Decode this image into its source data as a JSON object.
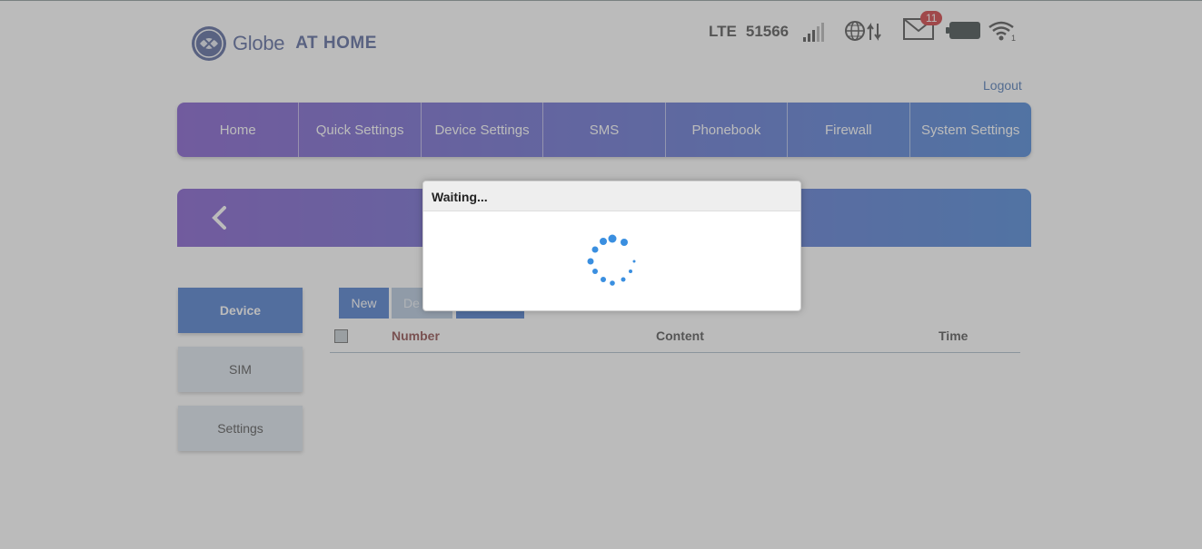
{
  "header": {
    "brand": "Globe",
    "brand_suffix": "AT HOME",
    "network_type": "LTE",
    "network_id": "51566",
    "sms_badge_count": "11",
    "logout_label": "Logout"
  },
  "nav": {
    "items": [
      "Home",
      "Quick Settings",
      "Device Settings",
      "SMS",
      "Phonebook",
      "Firewall",
      "System Settings"
    ]
  },
  "sidebar": {
    "items": [
      "Device",
      "SIM",
      "Settings"
    ],
    "active": "Device"
  },
  "toolbar": {
    "new_label": "New",
    "delete_label_partial": "De"
  },
  "table": {
    "columns": [
      "Number",
      "Content",
      "Time"
    ]
  },
  "dialog": {
    "title": "Waiting..."
  },
  "colors": {
    "accent_blue": "#2c64c4",
    "nav_gradient_start": "#6b3fc4",
    "nav_gradient_end": "#2b6fcf",
    "badge_red": "#c8191d",
    "spinner_blue": "#3a8fe0"
  },
  "icons": [
    "globe-logo-icon",
    "signal-bars-icon",
    "globe-data-icon",
    "mail-icon",
    "battery-icon",
    "wifi-icon",
    "back-chevron-icon",
    "spinner-icon"
  ]
}
